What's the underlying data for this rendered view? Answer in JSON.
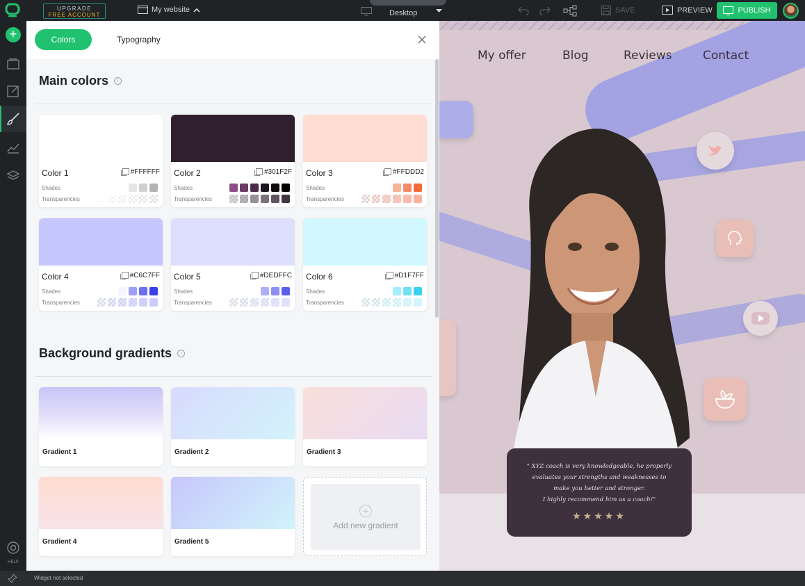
{
  "topbar": {
    "upgrade_line1": "UPGRADE",
    "upgrade_line2": "FREE ACCOUNT",
    "site_name": "My website",
    "device": "Desktop",
    "save_label": "SAVE",
    "preview_label": "PREVIEW",
    "publish_label": "PUBLISH"
  },
  "rail": {
    "help_label": "HELP"
  },
  "status": {
    "text": "Widget not selected"
  },
  "panel": {
    "tabs": [
      {
        "label": "Colors"
      },
      {
        "label": "Typography"
      }
    ],
    "main_colors_title": "Main colors",
    "gradients_title": "Background gradients",
    "shades_label": "Shades",
    "transparencies_label": "Transparencies",
    "colors": [
      {
        "name": "Color 1",
        "hex": "#FFFFFF",
        "swatch": "#FFFFFF",
        "shades": [
          "#e6e6e6",
          "#cfcfcf",
          "#b3b3b3"
        ],
        "trans": [
          "rgba(255,255,255,0.9)",
          "rgba(255,255,255,0.75)",
          "rgba(255,255,255,0.6)",
          "rgba(255,255,255,0.45)",
          "rgba(255,255,255,0.3)",
          "rgba(255,255,255,0.15)"
        ]
      },
      {
        "name": "Color 2",
        "hex": "#301F2F",
        "swatch": "#301F2F",
        "shades": [
          "#8c4f88",
          "#6b3a67",
          "#4c2b4a",
          "#1c141c",
          "#0e0a0e",
          "#000000"
        ],
        "trans": [
          "rgba(48,31,47,0.15)",
          "rgba(48,31,47,0.3)",
          "rgba(48,31,47,0.45)",
          "rgba(48,31,47,0.6)",
          "rgba(48,31,47,0.75)",
          "rgba(48,31,47,0.9)"
        ]
      },
      {
        "name": "Color 3",
        "hex": "#FFDDD2",
        "swatch": "#FFDDD2",
        "shades": [
          "#f7b39a",
          "#f48a66",
          "#f26a3a"
        ],
        "trans": [
          "rgba(255,170,150,0.15)",
          "rgba(255,170,150,0.3)",
          "rgba(255,170,150,0.45)",
          "rgba(255,170,150,0.6)",
          "rgba(255,170,150,0.75)",
          "rgba(255,170,150,0.9)"
        ]
      },
      {
        "name": "Color 4",
        "hex": "#C6C7FF",
        "swatch": "#C6C7FF",
        "shades": [
          "#f5f5ff",
          "#9c9ef7",
          "#6c6ff0",
          "#3a3ee6"
        ],
        "trans": [
          "rgba(198,199,255,0.15)",
          "rgba(198,199,255,0.3)",
          "rgba(198,199,255,0.45)",
          "rgba(198,199,255,0.6)",
          "rgba(198,199,255,0.75)",
          "rgba(198,199,255,0.9)"
        ]
      },
      {
        "name": "Color 5",
        "hex": "#DEDFFC",
        "swatch": "#DEDFFC",
        "shades": [
          "#adb0f6",
          "#8d90f0",
          "#5c5fe8"
        ],
        "trans": [
          "rgba(222,223,252,0.15)",
          "rgba(222,223,252,0.3)",
          "rgba(222,223,252,0.45)",
          "rgba(222,223,252,0.6)",
          "rgba(222,223,252,0.75)",
          "rgba(222,223,252,0.9)"
        ]
      },
      {
        "name": "Color 6",
        "hex": "#D1F7FF",
        "swatch": "#D1F7FF",
        "shades": [
          "#a3eefc",
          "#6fe0f7",
          "#39d1f1"
        ],
        "trans": [
          "rgba(209,247,255,0.15)",
          "rgba(209,247,255,0.3)",
          "rgba(209,247,255,0.45)",
          "rgba(209,247,255,0.6)",
          "rgba(209,247,255,0.75)",
          "rgba(209,247,255,0.9)"
        ]
      }
    ],
    "gradients": [
      {
        "name": "Gradient 1",
        "css": "linear-gradient(180deg,#c9c4f7 0%,#e5e2fa 60%,#ffffff 100%)"
      },
      {
        "name": "Gradient 2",
        "css": "linear-gradient(135deg,#d8dafd 0%,#d3f3fb 100%)"
      },
      {
        "name": "Gradient 3",
        "css": "linear-gradient(135deg,#f9dfda 0%,#e8dbf4 100%)"
      },
      {
        "name": "Gradient 4",
        "css": "linear-gradient(180deg,#ffdcd0 0%,#f7e3e8 100%)"
      },
      {
        "name": "Gradient 5",
        "css": "linear-gradient(135deg,#c7c7fb 0%,#d1f3fb 100%)"
      }
    ],
    "add_gradient_label": "Add new gradient"
  },
  "canvas": {
    "nav": [
      "My offer",
      "Blog",
      "Reviews",
      "Contact"
    ],
    "testimonial_lines": [
      "\" XYZ coach is very knowledgeable, he properly",
      "evaluates your strengths and weaknesses to",
      "make you better and stronger.",
      "I highly recommend him as a coach!\""
    ],
    "stars": "★★★★★"
  },
  "colors": {
    "accent": "#21c26f",
    "dark": "#1f2326"
  }
}
